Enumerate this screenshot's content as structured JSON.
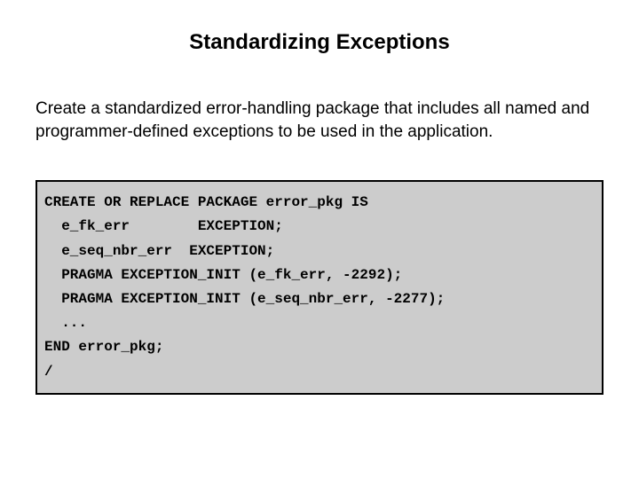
{
  "title": "Standardizing Exceptions",
  "description": "Create a standardized error-handling package that includes all named and programmer-defined exceptions to be used in the application.",
  "code": "CREATE OR REPLACE PACKAGE error_pkg IS\n  e_fk_err        EXCEPTION;\n  e_seq_nbr_err  EXCEPTION;\n  PRAGMA EXCEPTION_INIT (e_fk_err, -2292);\n  PRAGMA EXCEPTION_INIT (e_seq_nbr_err, -2277);\n  ...\nEND error_pkg;\n/"
}
